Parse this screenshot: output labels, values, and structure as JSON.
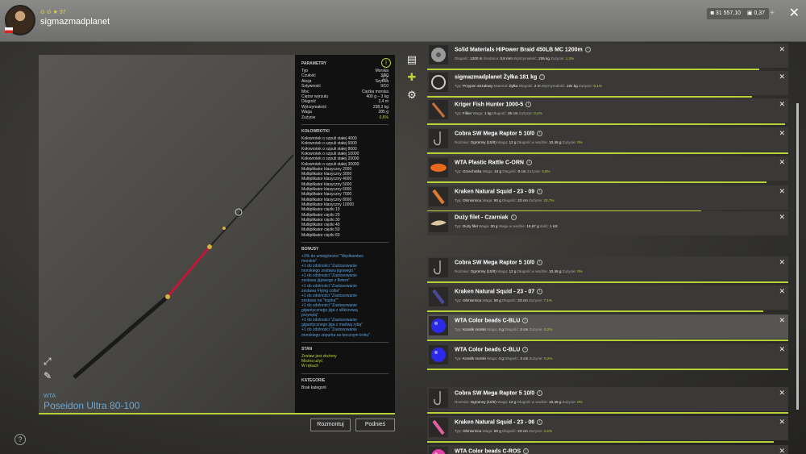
{
  "header": {
    "stats": "⊙ ⊙ ★ 37",
    "username": "sigmazmadplanet",
    "money": "31 557,10",
    "gold": "0,37",
    "plus": "+",
    "close": "✕"
  },
  "rod": {
    "brand": "WTA",
    "name": "Poseidon Ultra 80-100"
  },
  "panel": {
    "params_title": "PARAMETRY",
    "params": [
      {
        "k": "Typ",
        "v": "Morska"
      },
      {
        "k": "Czułość",
        "v": "3/10"
      },
      {
        "k": "Akcja",
        "v": "Szybka"
      },
      {
        "k": "Sztywność",
        "v": "9/10"
      },
      {
        "k": "Moc",
        "v": "Ciężka morska"
      },
      {
        "k": "Ciężar wyrzutu",
        "v": "400 g – 3 kg"
      },
      {
        "k": "Długość",
        "v": "2,4 m"
      },
      {
        "k": "Wytrzymałość",
        "v": "238,3 kg"
      },
      {
        "k": "Waga",
        "v": "285 g"
      },
      {
        "k": "Zużycie",
        "v": "0,6%",
        "green": true
      }
    ],
    "reels_title": "KOŁOWROTKI",
    "reels": [
      "Kołowrotek o szpuli stałej 4000",
      "Kołowrotek o szpuli stałej 6000",
      "Kołowrotek o szpuli stałej 8000",
      "Kołowrotek o szpuli stałej 10000",
      "Kołowrotek o szpuli stałej 20000",
      "Kołowrotek o szpuli stałej 30000",
      "Multiplikator klasyczny 2000",
      "Multiplikator klasyczny 3000",
      "Multiplikator klasyczny 4000",
      "Multiplikator klasyczny 5000",
      "Multiplikator klasyczny 6000",
      "Multiplikator klasyczny 7000",
      "Multiplikator klasyczny 8000",
      "Multiplikator klasyczny 10000",
      "Multiplikator ciężki 10",
      "Multiplikator ciężki 20",
      "Multiplikator ciężki 30",
      "Multiplikator ciężki 40",
      "Multiplikator ciężki 50",
      "Multiplikator ciężki 60"
    ],
    "bonus_title": "BONUSY",
    "bonuses": [
      "+3% do umiejętności \"Wędkarstwo",
      "morskie\"",
      "+1 do zdolności \"Zastosowanie",
      "morskiego zestawu jigowego.\"",
      "+1 do zdolności \"Zastosowanie",
      "zestawu jigowego z fletem\"",
      "+1 do zdolności \"Zastosowanie",
      "zestawu Flying collar\"",
      "+1 do zdolności \"Zastosowanie",
      "zestawu na \"trupka\"\"",
      "+1 do zdolności \"Zastosowanie",
      "gigantycznego jiga z silikonową",
      "przynętą\"",
      "+1 do zdolności \"Zastosowanie",
      "gigantycznego jiga z martwą rybą\"",
      "+1 do zdolności \"Zastosowanie",
      "morskiego zepurka na bocznym troku\""
    ],
    "state_title": "STAN",
    "states": [
      "Zestaw jest złożony",
      "Można użyć",
      "W rękach"
    ],
    "category_title": "KATEGORIE",
    "category": "Brak kategorii"
  },
  "buttons": {
    "disassemble": "Rozmontuj",
    "pickup": "Podnieś"
  },
  "help": "?",
  "items": [
    {
      "name": "Solid Materials HiPower Braid 450LB MC 1200m",
      "det": [
        [
          "Długość:",
          "1200 m"
        ],
        [
          "Średnica:",
          "0,8 mm"
        ],
        [
          "Wytrzymałość:",
          "205 kg"
        ],
        [
          "Zużycie:",
          "1,3%"
        ]
      ],
      "prog": 0.92,
      "thumb": "spool",
      "color": "#999"
    },
    {
      "name": "sigmazmadplanet Żyłka 181 kg",
      "det": [
        [
          "Typ:",
          "Przypon strzałowy"
        ],
        [
          "Materiał:",
          "Żyłka"
        ],
        [
          "Długość:",
          "2 m"
        ],
        [
          "Wytrzymałość:",
          "181 kg"
        ],
        [
          "Zużycie:",
          "9,1%"
        ]
      ],
      "prog": 0.9,
      "thumb": "ring",
      "color": "#ccc"
    },
    {
      "name": "Kriger Fish Hunter 1000-5",
      "det": [
        [
          "Typ:",
          "Filker"
        ],
        [
          "Waga:",
          "1 kg"
        ],
        [
          "Długość:",
          "25 cm"
        ],
        [
          "Zużycie:",
          "0,4%"
        ]
      ],
      "prog": 0.99,
      "thumb": "stick",
      "color": "#c8703a"
    },
    {
      "name": "Cobra SW Mega Raptor 5 10/0",
      "det": [
        [
          "Rozmiar:",
          "Ogromny (10/0)"
        ],
        [
          "Waga:",
          "12 g"
        ],
        [
          "Długość w wodzie:",
          "10,46 g"
        ],
        [
          "Zużycie:",
          "0%"
        ]
      ],
      "prog": 1.0,
      "thumb": "hook",
      "color": "#aaa"
    },
    {
      "name": "WTA Plastic Rattle C-ORN",
      "det": [
        [
          "Typ:",
          "Grzechotka"
        ],
        [
          "Waga:",
          "10 g"
        ],
        [
          "Długość:",
          "8 cm"
        ],
        [
          "Zużycie:",
          "3,8%"
        ]
      ],
      "prog": 0.94,
      "thumb": "rattle",
      "color": "#e86a1a"
    },
    {
      "name": "Kraken Natural Squid - 23 - 09",
      "det": [
        [
          "Typ:",
          "Ośmiornica"
        ],
        [
          "Waga:",
          "50 g"
        ],
        [
          "Długość:",
          "23 cm"
        ],
        [
          "Zużycie:",
          "23,7%"
        ]
      ],
      "prog": 0.76,
      "thumb": "squid",
      "color": "#e07a2a"
    },
    {
      "name": "Duży filet - Czarniak",
      "det": [
        [
          "Typ:",
          "Duży filet"
        ],
        [
          "Waga:",
          "30 g"
        ],
        [
          "Waga w wodzie:",
          "16,67 g"
        ],
        [
          "Ilość:",
          "1 szt"
        ]
      ],
      "prog": 0,
      "thumb": "filet",
      "color": "#d9c7a0"
    },
    {
      "name": "Cobra SW Mega Raptor 5 10/0",
      "det": [
        [
          "Rozmiar:",
          "Ogromny (10/0)"
        ],
        [
          "Waga:",
          "12 g"
        ],
        [
          "Długość w wodzie:",
          "10,46 g"
        ],
        [
          "Zużycie:",
          "0%"
        ]
      ],
      "prog": 1.0,
      "thumb": "hook",
      "color": "#aaa"
    },
    {
      "name": "Kraken Natural Squid - 23 - 07",
      "det": [
        [
          "Typ:",
          "Ośmiornica"
        ],
        [
          "Waga:",
          "50 g"
        ],
        [
          "Długość:",
          "23 cm"
        ],
        [
          "Zużycie:",
          "7,1%"
        ]
      ],
      "prog": 0.93,
      "thumb": "squid",
      "color": "#4a4a9a"
    },
    {
      "name": "WTA Color beads C-BLU",
      "det": [
        [
          "Typ:",
          "Koralik morski"
        ],
        [
          "Waga:",
          "4 g"
        ],
        [
          "Długość:",
          "2 cm"
        ],
        [
          "Zużycie:",
          "0,2%"
        ]
      ],
      "prog": 1.0,
      "thumb": "bead",
      "color": "#2a2ae8",
      "sel": true
    },
    {
      "name": "WTA Color beads C-BLU",
      "det": [
        [
          "Typ:",
          "Koralik morski"
        ],
        [
          "Waga:",
          "4 g"
        ],
        [
          "Długość:",
          "2 cm"
        ],
        [
          "Zużycie:",
          "0,2%"
        ]
      ],
      "prog": 1.0,
      "thumb": "bead",
      "color": "#2a2ae8"
    },
    {
      "name": "Cobra SW Mega Raptor 5 10/0",
      "det": [
        [
          "Rozmiar:",
          "Ogromny (10/0)"
        ],
        [
          "Waga:",
          "12 g"
        ],
        [
          "Długość w wodzie:",
          "10,46 g"
        ],
        [
          "Zużycie:",
          "0%"
        ]
      ],
      "prog": 1.0,
      "thumb": "hook",
      "color": "#aaa"
    },
    {
      "name": "Kraken Natural Squid - 23 - 06",
      "det": [
        [
          "Typ:",
          "Ośmiornica"
        ],
        [
          "Waga:",
          "50 g"
        ],
        [
          "Długość:",
          "23 cm"
        ],
        [
          "Zużycie:",
          "4,4%"
        ]
      ],
      "prog": 0.96,
      "thumb": "squid",
      "color": "#e060a0"
    },
    {
      "name": "WTA Color beads C-ROS",
      "det": [],
      "prog": 0,
      "thumb": "bead",
      "color": "#e040a0"
    }
  ]
}
